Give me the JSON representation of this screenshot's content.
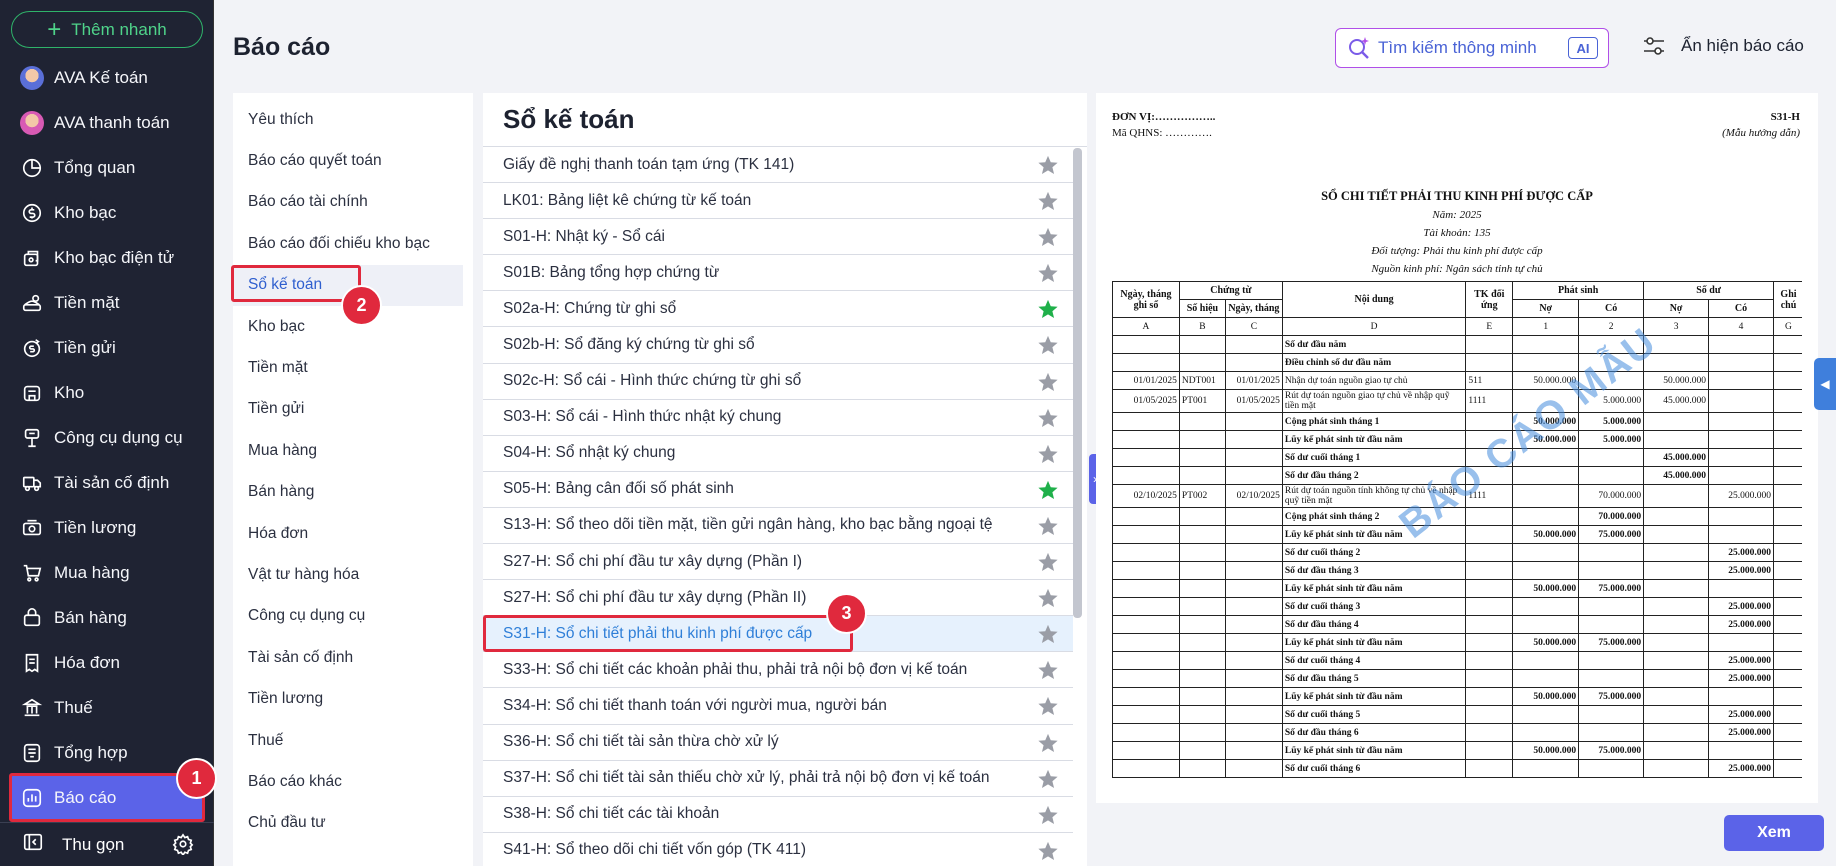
{
  "sidebar": {
    "quick_add": "Thêm nhanh",
    "items": [
      {
        "label": "AVA Kế toán",
        "icon": "ava-accounting-avatar"
      },
      {
        "label": "AVA thanh toán",
        "icon": "ava-payment-avatar"
      },
      {
        "label": "Tổng quan",
        "icon": "pie-chart-icon"
      },
      {
        "label": "Kho bạc",
        "icon": "coin-icon"
      },
      {
        "label": "Kho bạc điện tử",
        "icon": "electronic-treasury-icon"
      },
      {
        "label": "Tiền mặt",
        "icon": "cash-icon"
      },
      {
        "label": "Tiền gửi",
        "icon": "deposit-icon"
      },
      {
        "label": "Kho",
        "icon": "warehouse-icon"
      },
      {
        "label": "Công cụ dụng cụ",
        "icon": "tools-icon"
      },
      {
        "label": "Tài sản cố định",
        "icon": "truck-icon"
      },
      {
        "label": "Tiền lương",
        "icon": "salary-icon"
      },
      {
        "label": "Mua hàng",
        "icon": "cart-icon"
      },
      {
        "label": "Bán hàng",
        "icon": "sales-icon"
      },
      {
        "label": "Hóa đơn",
        "icon": "invoice-icon"
      },
      {
        "label": "Thuế",
        "icon": "tax-icon"
      }
    ],
    "summary": "Tổng hợp",
    "active": "Báo cáo",
    "collapse": "Thu gọn"
  },
  "badges": {
    "one": "1",
    "two": "2",
    "three": "3"
  },
  "header": {
    "title": "Báo cáo",
    "search_placeholder": "Tìm kiếm thông minh",
    "ai": "AI",
    "toggle_reports": "Ẩn hiện báo cáo"
  },
  "categories": [
    "Yêu thích",
    "Báo cáo quyết toán",
    "Báo cáo tài chính",
    "Báo cáo đối chiếu kho bạc",
    "Sổ kế toán",
    "Kho bạc",
    "Tiền mặt",
    "Tiền gửi",
    "Mua hàng",
    "Bán hàng",
    "Hóa đơn",
    "Vật tư hàng hóa",
    "Công cụ dụng cụ",
    "Tài sản cố định",
    "Tiền lương",
    "Thuế",
    "Báo cáo khác",
    "Chủ đầu tư"
  ],
  "report_list": {
    "title": "Sổ kế toán",
    "items": [
      {
        "label": "Giấy đề nghị thanh toán tạm ứng (TK 141)",
        "favorite": false
      },
      {
        "label": "LK01: Bảng liệt kê chứng từ kế toán",
        "favorite": false
      },
      {
        "label": "S01-H: Nhật ký - Sổ cái",
        "favorite": false
      },
      {
        "label": "S01B: Bảng tổng hợp chứng từ",
        "favorite": false
      },
      {
        "label": "S02a-H: Chứng từ ghi sổ",
        "favorite": true
      },
      {
        "label": "S02b-H: Sổ đăng ký chứng từ ghi sổ",
        "favorite": false
      },
      {
        "label": "S02c-H: Sổ cái - Hình thức chứng từ ghi sổ",
        "favorite": false
      },
      {
        "label": "S03-H: Sổ cái - Hình thức nhật ký chung",
        "favorite": false
      },
      {
        "label": "S04-H: Sổ nhật ký chung",
        "favorite": false
      },
      {
        "label": "S05-H: Bảng cân đối số phát sinh",
        "favorite": true
      },
      {
        "label": "S13-H: Sổ theo dõi tiền mặt, tiền gửi ngân hàng, kho bạc bằng ngoại tệ",
        "favorite": false
      },
      {
        "label": "S27-H: Sổ chi phí đầu tư xây dựng (Phần I)",
        "favorite": false
      },
      {
        "label": "S27-H: Sổ chi phí đầu tư xây dựng (Phần II)",
        "favorite": false
      },
      {
        "label": "S31-H: Sổ chi tiết phải thu kinh phí được cấp",
        "favorite": false
      },
      {
        "label": "S33-H: Sổ chi tiết các khoản phải thu, phải trả nội bộ đơn vị kế toán",
        "favorite": false
      },
      {
        "label": "S34-H: Sổ chi tiết thanh toán với người mua, người bán",
        "favorite": false
      },
      {
        "label": "S36-H: Sổ chi tiết tài sản thừa chờ xử lý",
        "favorite": false
      },
      {
        "label": "S37-H: Sổ chi tiết tài sản thiếu chờ xử lý, phải trả nội bộ đơn vị kế toán",
        "favorite": false
      },
      {
        "label": "S38-H: Sổ chi tiết các tài khoản",
        "favorite": false
      },
      {
        "label": "S41-H: Sổ theo dõi chi tiết vốn góp (TK 411)",
        "favorite": false
      }
    ],
    "colors": {
      "star_off": "#9a9da6",
      "star_on": "#1fb04a"
    }
  },
  "preview": {
    "unit": "ĐƠN VỊ:……………..",
    "qhns": "Mã QHNS: ………….",
    "code": "S31-H",
    "guide": "(Mẫu hướng dẫn)",
    "heading": "SỔ CHI TIẾT PHẢI THU KINH PHÍ ĐƯỢC CẤP",
    "year": "Năm: 2025",
    "account": "Tài khoản: 135",
    "subject": "Đối tượng: Phải thu kinh phí được cấp",
    "source": "Nguồn kinh phí: Ngân sách tỉnh tự chủ",
    "watermark": "BÁO CÁO MẪU",
    "headers": {
      "date": "Ngày, tháng ghi sổ",
      "voucher": "Chứng từ",
      "voucher_no": "Số hiệu",
      "voucher_date": "Ngày, tháng",
      "content": "Nội dung",
      "contra": "TK đối ứng",
      "incurred": "Phát sinh",
      "balance": "Số dư",
      "debit": "Nợ",
      "credit": "Có",
      "note": "Ghi chú"
    },
    "col_codes": [
      "A",
      "B",
      "C",
      "D",
      "E",
      "1",
      "2",
      "3",
      "4",
      "G"
    ],
    "rows": [
      {
        "c": [
          "",
          "",
          "",
          "Số dư đầu năm",
          "",
          "",
          "",
          "",
          "",
          ""
        ],
        "bold": true
      },
      {
        "c": [
          "",
          "",
          "",
          "Điều chỉnh số dư đầu năm",
          "",
          "",
          "",
          "",
          "",
          ""
        ],
        "bold": true
      },
      {
        "c": [
          "01/01/2025",
          "NDT001",
          "01/01/2025",
          "Nhận dự toán nguồn giao tự chủ",
          "511",
          "50.000.000",
          "",
          "50.000.000",
          "",
          ""
        ],
        "bold": false
      },
      {
        "c": [
          "01/05/2025",
          "PT001",
          "01/05/2025",
          "Rút dự toán nguồn giao tự chủ về nhập quỹ tiền mặt",
          "1111",
          "",
          "5.000.000",
          "45.000.000",
          "",
          ""
        ],
        "bold": false
      },
      {
        "c": [
          "",
          "",
          "",
          "Cộng phát sinh tháng 1",
          "",
          "50.000.000",
          "5.000.000",
          "",
          "",
          ""
        ],
        "bold": true
      },
      {
        "c": [
          "",
          "",
          "",
          "Lũy kế phát sinh từ đầu năm",
          "",
          "50.000.000",
          "5.000.000",
          "",
          "",
          ""
        ],
        "bold": true
      },
      {
        "c": [
          "",
          "",
          "",
          "Số dư cuối tháng 1",
          "",
          "",
          "",
          "45.000.000",
          "",
          ""
        ],
        "bold": true
      },
      {
        "c": [
          "",
          "",
          "",
          "Số dư đầu tháng 2",
          "",
          "",
          "",
          "45.000.000",
          "",
          ""
        ],
        "bold": true
      },
      {
        "c": [
          "02/10/2025",
          "PT002",
          "02/10/2025",
          "Rút dự toán nguồn tính không tự chủ về nhập quỹ tiền mặt",
          "1111",
          "",
          "70.000.000",
          "",
          "25.000.000",
          ""
        ],
        "bold": false
      },
      {
        "c": [
          "",
          "",
          "",
          "Cộng phát sinh tháng 2",
          "",
          "",
          "70.000.000",
          "",
          "",
          ""
        ],
        "bold": true
      },
      {
        "c": [
          "",
          "",
          "",
          "Lũy kế phát sinh từ đầu năm",
          "",
          "50.000.000",
          "75.000.000",
          "",
          "",
          ""
        ],
        "bold": true
      },
      {
        "c": [
          "",
          "",
          "",
          "Số dư cuối tháng 2",
          "",
          "",
          "",
          "",
          "25.000.000",
          ""
        ],
        "bold": true
      },
      {
        "c": [
          "",
          "",
          "",
          "Số dư đầu tháng 3",
          "",
          "",
          "",
          "",
          "25.000.000",
          ""
        ],
        "bold": true
      },
      {
        "c": [
          "",
          "",
          "",
          "Lũy kế phát sinh từ đầu năm",
          "",
          "50.000.000",
          "75.000.000",
          "",
          "",
          ""
        ],
        "bold": true
      },
      {
        "c": [
          "",
          "",
          "",
          "Số dư cuối tháng 3",
          "",
          "",
          "",
          "",
          "25.000.000",
          ""
        ],
        "bold": true
      },
      {
        "c": [
          "",
          "",
          "",
          "Số dư đầu tháng 4",
          "",
          "",
          "",
          "",
          "25.000.000",
          ""
        ],
        "bold": true
      },
      {
        "c": [
          "",
          "",
          "",
          "Lũy kế phát sinh từ đầu năm",
          "",
          "50.000.000",
          "75.000.000",
          "",
          "",
          ""
        ],
        "bold": true
      },
      {
        "c": [
          "",
          "",
          "",
          "Số dư cuối tháng 4",
          "",
          "",
          "",
          "",
          "25.000.000",
          ""
        ],
        "bold": true
      },
      {
        "c": [
          "",
          "",
          "",
          "Số dư đầu tháng 5",
          "",
          "",
          "",
          "",
          "25.000.000",
          ""
        ],
        "bold": true
      },
      {
        "c": [
          "",
          "",
          "",
          "Lũy kế phát sinh từ đầu năm",
          "",
          "50.000.000",
          "75.000.000",
          "",
          "",
          ""
        ],
        "bold": true
      },
      {
        "c": [
          "",
          "",
          "",
          "Số dư cuối tháng 5",
          "",
          "",
          "",
          "",
          "25.000.000",
          ""
        ],
        "bold": true
      },
      {
        "c": [
          "",
          "",
          "",
          "Số dư đầu tháng 6",
          "",
          "",
          "",
          "",
          "25.000.000",
          ""
        ],
        "bold": true
      },
      {
        "c": [
          "",
          "",
          "",
          "Lũy kế phát sinh từ đầu năm",
          "",
          "50.000.000",
          "75.000.000",
          "",
          "",
          ""
        ],
        "bold": true
      },
      {
        "c": [
          "",
          "",
          "",
          "Số dư cuối tháng 6",
          "",
          "",
          "",
          "",
          "25.000.000",
          ""
        ],
        "bold": true
      }
    ]
  },
  "view_button": "Xem"
}
